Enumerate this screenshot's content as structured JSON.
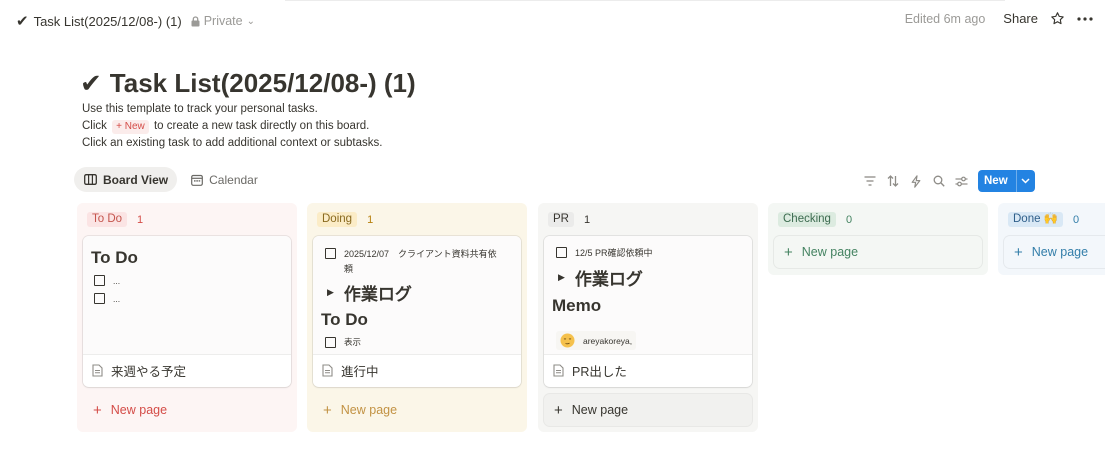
{
  "topbar": {
    "breadcrumb_title": "Task List(2025/12/08-) (1)",
    "privacy": "Private",
    "edited": "Edited 6m ago",
    "share": "Share"
  },
  "page": {
    "title": "Task List(2025/12/08-) (1)",
    "desc_line1": "Use this template to track your personal tasks.",
    "desc_line2_before": "Click",
    "desc_line2_pill": "+ New",
    "desc_line2_after": "to create a new task directly on this board.",
    "desc_line3": "Click an existing task to add additional context or subtasks."
  },
  "views": {
    "board": "Board View",
    "calendar": "Calendar"
  },
  "toolbar": {
    "new_label": "New"
  },
  "columns": [
    {
      "name": "To Do",
      "count": "1",
      "bg": "#fdf5f4",
      "pill_bg": "#fbe4e4",
      "pill_color": "#c4554d",
      "count_color": "#d44c47",
      "new_page": "New page",
      "new_color": "#d44c47",
      "card": {
        "heading": "To Do",
        "items": [
          "...",
          "..."
        ],
        "title": "来週やる予定"
      }
    },
    {
      "name": "Doing",
      "count": "1",
      "bg": "#fbf6e8",
      "pill_bg": "#fbecc7",
      "pill_color": "#8a6a1f",
      "count_color": "#b7800e",
      "new_page": "New page",
      "new_color": "#c29243",
      "card": {
        "task_line1": "2025/12/07　クライアント資料共有依",
        "task_line2": "頼",
        "toggle": "作業ログ",
        "heading": "To Do",
        "item": "表示",
        "title": "進行中"
      }
    },
    {
      "name": "PR",
      "count": "1",
      "bg": "#f6f6f4",
      "pill_bg": "#ebebea",
      "pill_color": "#37352f",
      "count_color": "#37352f",
      "new_page": "New page",
      "new_color": "#37352f",
      "card": {
        "task": "12/5 PR確認依頼中",
        "toggle": "作業ログ",
        "heading": "Memo",
        "mention": "areyakoreya,",
        "title": "PR出した"
      }
    },
    {
      "name": "Checking",
      "count": "0",
      "bg": "#f4f7f4",
      "pill_bg": "#dcebe0",
      "pill_color": "#3c6b4f",
      "count_color": "#448361",
      "new_page": "New page",
      "new_color": "#448361"
    },
    {
      "name": "Done 🙌",
      "count": "0",
      "bg": "#f3f7fb",
      "pill_bg": "#d9e8f5",
      "pill_color": "#2f5f8a",
      "count_color": "#337ea9",
      "new_page": "New page",
      "new_color": "#337ea9"
    }
  ],
  "colors": {
    "accent": "#2383e2",
    "text": "#37352f",
    "muted": "#9b9a97"
  }
}
